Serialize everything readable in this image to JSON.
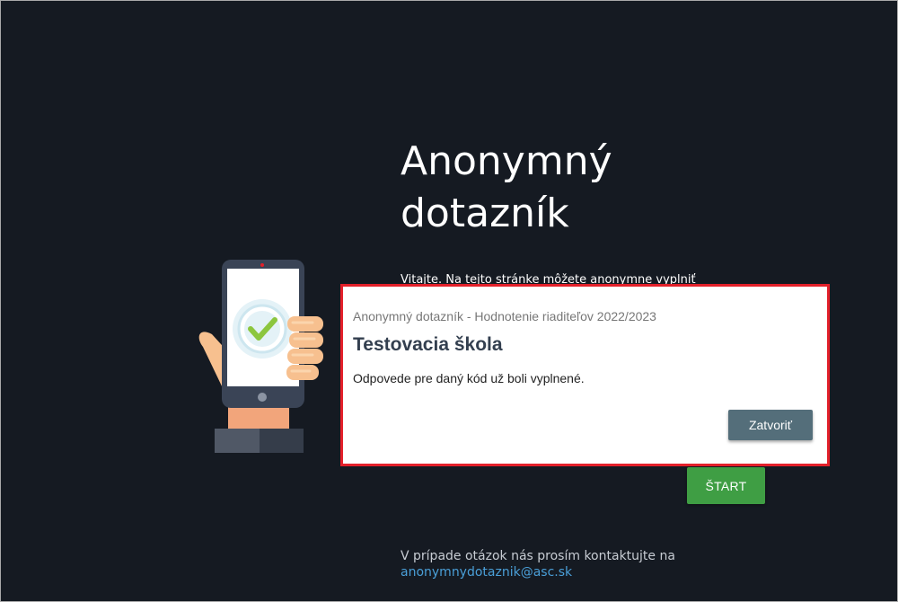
{
  "page": {
    "title": "Anonymný dotazník",
    "intro": "Vitajte. Na tejto stránke môžete anonymne vyplniť",
    "start_label": "ŠTART",
    "contact_text": "V prípade otázok nás prosím kontaktujte na",
    "contact_email": "anonymnydotaznik@asc.sk"
  },
  "dialog": {
    "subtitle": "Anonymný dotazník - Hodnotenie riaditeľov 2022/2023",
    "title": "Testovacia škola",
    "message": "Odpovede pre daný kód už boli vyplnené.",
    "close_label": "Zatvoriť"
  },
  "colors": {
    "background": "#151a22",
    "start_button": "#3f9e44",
    "close_button": "#546e7a",
    "link": "#4a9fd8",
    "highlight": "#e3202a"
  },
  "icons": {
    "illustration": "hand-holding-phone-checkmark-icon"
  }
}
